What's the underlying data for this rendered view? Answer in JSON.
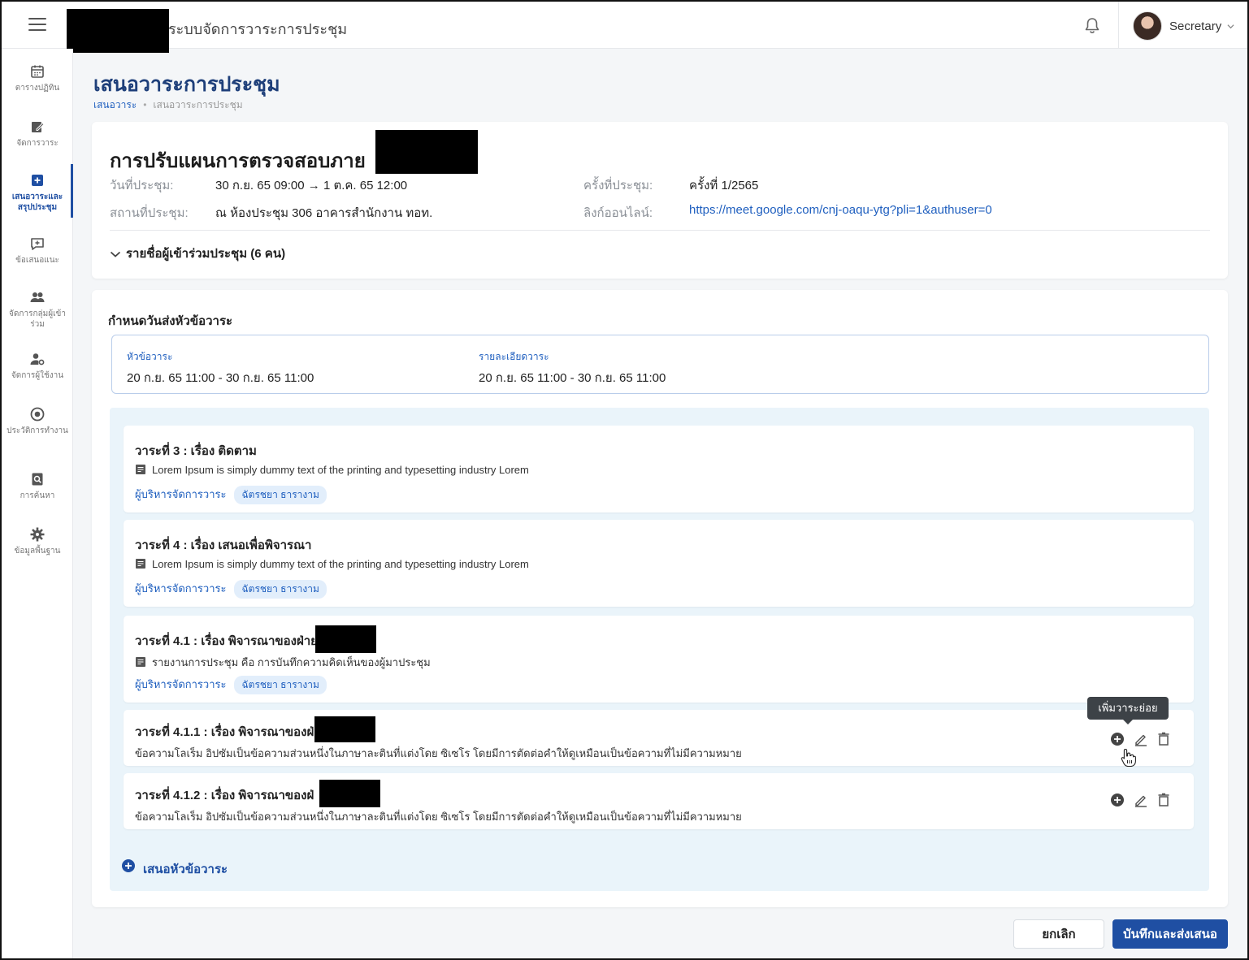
{
  "app": {
    "title": "ระบบจัดการวาระการประชุม",
    "user_name": "Secretary"
  },
  "sidebar": {
    "items": [
      {
        "label": "ตารางปฏิทิน",
        "icon": "calendar-icon"
      },
      {
        "label": "จัดการวาระ",
        "icon": "edit-note-icon"
      },
      {
        "label": "เสนอวาระและสรุปประชุม",
        "icon": "add-box-icon"
      },
      {
        "label": "ข้อเสนอแนะ",
        "icon": "comment-add-icon"
      },
      {
        "label": "จัดการกลุ่มผู้เข้าร่วม",
        "icon": "group-icon"
      },
      {
        "label": "จัดการผู้ใช้งาน",
        "icon": "user-settings-icon"
      },
      {
        "label": "ประวัติการทำงาน",
        "icon": "history-icon"
      },
      {
        "label": "การค้นหา",
        "icon": "search-doc-icon"
      },
      {
        "label": "ข้อมูลพื้นฐาน",
        "icon": "gear-icon"
      }
    ],
    "active_index": 2
  },
  "page": {
    "title": "เสนอวาระการประชุม",
    "breadcrumb": [
      "เสนอวาระ",
      "เสนอวาระการประชุม"
    ]
  },
  "meeting": {
    "title": "การปรับแผนการตรวจสอบภาย",
    "date_label": "วันที่ประชุม:",
    "date_value": "30 ก.ย. 65 09:00 → 1 ต.ค. 65 12:00",
    "place_label": "สถานที่ประชุม:",
    "place_value": "ณ ห้องประชุม 306 อาคารสำนักงาน ทอท.",
    "round_label": "ครั้งที่ประชุม:",
    "round_value": "ครั้งที่ 1/2565",
    "link_label": "ลิงก์ออนไลน์:",
    "link_value": "https://meet.google.com/cnj-oaqu-ytg?pli=1&authuser=0",
    "attendees_toggle": "รายชื่อผู้เข้าร่วมประชุม (6 คน)"
  },
  "deadline": {
    "title": "กำหนดวันส่งหัวข้อวาระ",
    "topic_label": "หัวข้อวาระ",
    "topic_value": "20 ก.ย. 65 11:00 - 30 ก.ย. 65 11:00",
    "detail_label": "รายละเอียดวาระ",
    "detail_value": "20 ก.ย. 65 11:00 - 30 ก.ย. 65 11:00"
  },
  "agenda_items": [
    {
      "title": "วาระที่ 3 : เรื่อง ติดตาม",
      "desc": "Lorem Ipsum is simply dummy text of the printing and typesetting industry Lorem",
      "role": "ผู้บริหารจัดการวาระ",
      "person": "ฉัตรชยา ธารางาม"
    },
    {
      "title": "วาระที่ 4 : เรื่อง เสนอเพื่อพิจารณา",
      "desc": "Lorem Ipsum is simply dummy text of the printing and typesetting industry Lorem",
      "role": "ผู้บริหารจัดการวาระ",
      "person": "ฉัตรชยา ธารางาม"
    },
    {
      "title": "วาระที่ 4.1 : เรื่อง พิจารณาของฝ่าย",
      "desc": "รายงานการประชุม คือ การบันทึกความคิดเห็นของผู้มาประชุม",
      "role": "ผู้บริหารจัดการวาระ",
      "person": "ฉัตรชยา ธารางาม"
    }
  ],
  "sub_items": [
    {
      "title": "วาระที่ 4.1.1 : เรื่อง พิจารณาของฝ่",
      "desc": "ข้อความโลเร็ม อิปซัมเป็นข้อความส่วนหนึ่งในภาษาละตินที่แต่งโดย ซิเซโร โดยมีการตัดต่อคำให้ดูเหมือนเป็นข้อความที่ไม่มีความหมาย"
    },
    {
      "title": "วาระที่ 4.1.2 : เรื่อง พิจารณาของฝ่",
      "desc": "ข้อความโลเร็ม อิปซัมเป็นข้อความส่วนหนึ่งในภาษาละตินที่แต่งโดย ซิเซโร โดยมีการตัดต่อคำให้ดูเหมือนเป็นข้อความที่ไม่มีความหมาย"
    }
  ],
  "tooltip": "เพิ่มวาระย่อย",
  "add_topic_label": "เสนอหัวข้อวาระ",
  "buttons": {
    "cancel": "ยกเลิก",
    "save": "บันทึกและส่งเสนอ"
  },
  "colors": {
    "primary": "#1f4fa3",
    "link": "#1f5fbf",
    "agenda_bg": "#eaf4fa"
  }
}
